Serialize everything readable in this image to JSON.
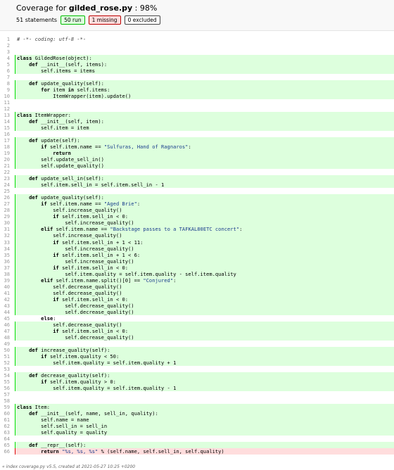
{
  "header": {
    "title_prefix": "Coverage for ",
    "title_file": "gilded_rose.py",
    "title_sep": " : ",
    "title_pct": "98%",
    "statements": "51 statements",
    "run_label": "50 run",
    "missing_label": "1 missing",
    "excluded_label": "0 excluded"
  },
  "lines": [
    {
      "n": "1",
      "s": "",
      "segs": [
        [
          "c",
          "# -*- coding: utf-8 -*-"
        ]
      ]
    },
    {
      "n": "2",
      "s": "",
      "segs": []
    },
    {
      "n": "3",
      "s": "",
      "segs": []
    },
    {
      "n": "4",
      "s": "run",
      "segs": [
        [
          "k",
          "class"
        ],
        [
          "",
          " GildedRose(object):"
        ]
      ]
    },
    {
      "n": "5",
      "s": "run",
      "segs": [
        [
          "",
          "    "
        ],
        [
          "k",
          "def"
        ],
        [
          "",
          " __init__(self, items):"
        ]
      ]
    },
    {
      "n": "6",
      "s": "run",
      "segs": [
        [
          "",
          "        self.items = items"
        ]
      ]
    },
    {
      "n": "7",
      "s": "",
      "segs": []
    },
    {
      "n": "8",
      "s": "run",
      "segs": [
        [
          "",
          "    "
        ],
        [
          "k",
          "def"
        ],
        [
          "",
          " update_quality(self):"
        ]
      ]
    },
    {
      "n": "9",
      "s": "run",
      "segs": [
        [
          "",
          "        "
        ],
        [
          "k",
          "for"
        ],
        [
          "",
          " item "
        ],
        [
          "k",
          "in"
        ],
        [
          "",
          " self.items:"
        ]
      ]
    },
    {
      "n": "10",
      "s": "run",
      "segs": [
        [
          "",
          "            ItemWrapper(item).update()"
        ]
      ]
    },
    {
      "n": "11",
      "s": "",
      "segs": []
    },
    {
      "n": "12",
      "s": "",
      "segs": []
    },
    {
      "n": "13",
      "s": "run",
      "segs": [
        [
          "k",
          "class"
        ],
        [
          "",
          " ItemWrapper:"
        ]
      ]
    },
    {
      "n": "14",
      "s": "run",
      "segs": [
        [
          "",
          "    "
        ],
        [
          "k",
          "def"
        ],
        [
          "",
          " __init__(self, item):"
        ]
      ]
    },
    {
      "n": "15",
      "s": "run",
      "segs": [
        [
          "",
          "        self.item = item"
        ]
      ]
    },
    {
      "n": "16",
      "s": "",
      "segs": []
    },
    {
      "n": "17",
      "s": "run",
      "segs": [
        [
          "",
          "    "
        ],
        [
          "k",
          "def"
        ],
        [
          "",
          " update(self):"
        ]
      ]
    },
    {
      "n": "18",
      "s": "run",
      "segs": [
        [
          "",
          "        "
        ],
        [
          "k",
          "if"
        ],
        [
          "",
          " self.item.name == "
        ],
        [
          "s",
          "\"Sulfuras, Hand of Ragnaros\""
        ],
        [
          "",
          ":"
        ]
      ]
    },
    {
      "n": "19",
      "s": "run",
      "segs": [
        [
          "",
          "            "
        ],
        [
          "k",
          "return"
        ]
      ]
    },
    {
      "n": "20",
      "s": "run",
      "segs": [
        [
          "",
          "        self.update_sell_in()"
        ]
      ]
    },
    {
      "n": "21",
      "s": "run",
      "segs": [
        [
          "",
          "        self.update_quality()"
        ]
      ]
    },
    {
      "n": "22",
      "s": "",
      "segs": []
    },
    {
      "n": "23",
      "s": "run",
      "segs": [
        [
          "",
          "    "
        ],
        [
          "k",
          "def"
        ],
        [
          "",
          " update_sell_in(self):"
        ]
      ]
    },
    {
      "n": "24",
      "s": "run",
      "segs": [
        [
          "",
          "        self.item.sell_in = self.item.sell_in - 1"
        ]
      ]
    },
    {
      "n": "25",
      "s": "",
      "segs": []
    },
    {
      "n": "26",
      "s": "run",
      "segs": [
        [
          "",
          "    "
        ],
        [
          "k",
          "def"
        ],
        [
          "",
          " update_quality(self):"
        ]
      ]
    },
    {
      "n": "27",
      "s": "run",
      "segs": [
        [
          "",
          "        "
        ],
        [
          "k",
          "if"
        ],
        [
          "",
          " self.item.name == "
        ],
        [
          "s",
          "\"Aged Brie\""
        ],
        [
          "",
          ":"
        ]
      ]
    },
    {
      "n": "28",
      "s": "run",
      "segs": [
        [
          "",
          "            self.increase_quality()"
        ]
      ]
    },
    {
      "n": "29",
      "s": "run",
      "segs": [
        [
          "",
          "            "
        ],
        [
          "k",
          "if"
        ],
        [
          "",
          " self.item.sell_in < 0:"
        ]
      ]
    },
    {
      "n": "30",
      "s": "run",
      "segs": [
        [
          "",
          "                self.increase_quality()"
        ]
      ]
    },
    {
      "n": "31",
      "s": "run",
      "segs": [
        [
          "",
          "        "
        ],
        [
          "k",
          "elif"
        ],
        [
          "",
          " self.item.name == "
        ],
        [
          "s",
          "\"Backstage passes to a TAFKAL80ETC concert\""
        ],
        [
          "",
          ":"
        ]
      ]
    },
    {
      "n": "32",
      "s": "run",
      "segs": [
        [
          "",
          "            self.increase_quality()"
        ]
      ]
    },
    {
      "n": "33",
      "s": "run",
      "segs": [
        [
          "",
          "            "
        ],
        [
          "k",
          "if"
        ],
        [
          "",
          " self.item.sell_in + 1 < 11:"
        ]
      ]
    },
    {
      "n": "34",
      "s": "run",
      "segs": [
        [
          "",
          "                self.increase_quality()"
        ]
      ]
    },
    {
      "n": "35",
      "s": "run",
      "segs": [
        [
          "",
          "            "
        ],
        [
          "k",
          "if"
        ],
        [
          "",
          " self.item.sell_in + 1 < 6:"
        ]
      ]
    },
    {
      "n": "36",
      "s": "run",
      "segs": [
        [
          "",
          "                self.increase_quality()"
        ]
      ]
    },
    {
      "n": "37",
      "s": "run",
      "segs": [
        [
          "",
          "            "
        ],
        [
          "k",
          "if"
        ],
        [
          "",
          " self.item.sell_in < 0:"
        ]
      ]
    },
    {
      "n": "38",
      "s": "run",
      "segs": [
        [
          "",
          "                self.item.quality = self.item.quality - self.item.quality"
        ]
      ]
    },
    {
      "n": "39",
      "s": "run",
      "segs": [
        [
          "",
          "        "
        ],
        [
          "k",
          "elif"
        ],
        [
          "",
          " self.item.name.split()[0] == "
        ],
        [
          "s",
          "\"Conjured\""
        ],
        [
          "",
          ":"
        ]
      ]
    },
    {
      "n": "40",
      "s": "run",
      "segs": [
        [
          "",
          "            self.decrease_quality()"
        ]
      ]
    },
    {
      "n": "41",
      "s": "run",
      "segs": [
        [
          "",
          "            self.decrease_quality()"
        ]
      ]
    },
    {
      "n": "42",
      "s": "run",
      "segs": [
        [
          "",
          "            "
        ],
        [
          "k",
          "if"
        ],
        [
          "",
          " self.item.sell_in < 0:"
        ]
      ]
    },
    {
      "n": "43",
      "s": "run",
      "segs": [
        [
          "",
          "                self.decrease_quality()"
        ]
      ]
    },
    {
      "n": "44",
      "s": "run",
      "segs": [
        [
          "",
          "                self.decrease_quality()"
        ]
      ]
    },
    {
      "n": "45",
      "s": "",
      "segs": [
        [
          "",
          "        "
        ],
        [
          "k",
          "else"
        ],
        [
          "",
          ":"
        ]
      ]
    },
    {
      "n": "46",
      "s": "run",
      "segs": [
        [
          "",
          "            self.decrease_quality()"
        ]
      ]
    },
    {
      "n": "47",
      "s": "run",
      "segs": [
        [
          "",
          "            "
        ],
        [
          "k",
          "if"
        ],
        [
          "",
          " self.item.sell_in < 0:"
        ]
      ]
    },
    {
      "n": "48",
      "s": "run",
      "segs": [
        [
          "",
          "                self.decrease_quality()"
        ]
      ]
    },
    {
      "n": "49",
      "s": "",
      "segs": []
    },
    {
      "n": "50",
      "s": "run",
      "segs": [
        [
          "",
          "    "
        ],
        [
          "k",
          "def"
        ],
        [
          "",
          " increase_quality(self):"
        ]
      ]
    },
    {
      "n": "51",
      "s": "run",
      "segs": [
        [
          "",
          "        "
        ],
        [
          "k",
          "if"
        ],
        [
          "",
          " self.item.quality < 50:"
        ]
      ]
    },
    {
      "n": "52",
      "s": "run",
      "segs": [
        [
          "",
          "            self.item.quality = self.item.quality + 1"
        ]
      ]
    },
    {
      "n": "53",
      "s": "",
      "segs": []
    },
    {
      "n": "54",
      "s": "run",
      "segs": [
        [
          "",
          "    "
        ],
        [
          "k",
          "def"
        ],
        [
          "",
          " decrease_quality(self):"
        ]
      ]
    },
    {
      "n": "55",
      "s": "run",
      "segs": [
        [
          "",
          "        "
        ],
        [
          "k",
          "if"
        ],
        [
          "",
          " self.item.quality > 0:"
        ]
      ]
    },
    {
      "n": "56",
      "s": "run",
      "segs": [
        [
          "",
          "            self.item.quality = self.item.quality - 1"
        ]
      ]
    },
    {
      "n": "57",
      "s": "",
      "segs": []
    },
    {
      "n": "58",
      "s": "",
      "segs": []
    },
    {
      "n": "59",
      "s": "run",
      "segs": [
        [
          "k",
          "class"
        ],
        [
          "",
          " Item:"
        ]
      ]
    },
    {
      "n": "60",
      "s": "run",
      "segs": [
        [
          "",
          "    "
        ],
        [
          "k",
          "def"
        ],
        [
          "",
          " __init__(self, name, sell_in, quality):"
        ]
      ]
    },
    {
      "n": "61",
      "s": "run",
      "segs": [
        [
          "",
          "        self.name = name"
        ]
      ]
    },
    {
      "n": "62",
      "s": "run",
      "segs": [
        [
          "",
          "        self.sell_in = sell_in"
        ]
      ]
    },
    {
      "n": "63",
      "s": "run",
      "segs": [
        [
          "",
          "        self.quality = quality"
        ]
      ]
    },
    {
      "n": "64",
      "s": "",
      "segs": []
    },
    {
      "n": "65",
      "s": "run",
      "segs": [
        [
          "",
          "    "
        ],
        [
          "k",
          "def"
        ],
        [
          "",
          " __repr__(self):"
        ]
      ]
    },
    {
      "n": "66",
      "s": "mis",
      "segs": [
        [
          "",
          "        "
        ],
        [
          "k",
          "return"
        ],
        [
          "",
          " "
        ],
        [
          "s",
          "\"%s, %s, %s\""
        ],
        [
          "",
          " % (self.name, self.sell_in, self.quality)"
        ]
      ]
    }
  ],
  "footer": {
    "index_link": "« index",
    "text": "   coverage.py v5.5, created at 2021-05-27 10:25 +0200"
  }
}
